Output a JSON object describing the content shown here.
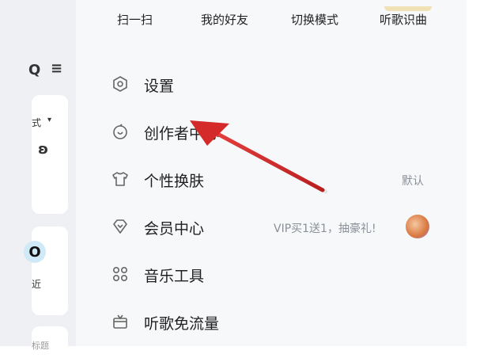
{
  "top_actions": [
    {
      "label": "扫一扫"
    },
    {
      "label": "我的好友"
    },
    {
      "label": "切换模式"
    },
    {
      "label": "听歌识曲"
    }
  ],
  "left_panel": {
    "mode_label": "式",
    "recent_label": "近",
    "bottom_label": "标题"
  },
  "menu": [
    {
      "label": "设置",
      "icon": "hexagon-settings-icon"
    },
    {
      "label": "创作者中心",
      "icon": "creator-icon"
    },
    {
      "label": "个性换肤",
      "icon": "tshirt-icon",
      "extra": "默认"
    },
    {
      "label": "会员中心",
      "icon": "diamond-icon",
      "extra": "VIP买1送1，抽豪礼!"
    },
    {
      "label": "音乐工具",
      "icon": "grid-tools-icon"
    },
    {
      "label": "听歌免流量",
      "icon": "gift-box-icon"
    }
  ],
  "colors": {
    "arrow": "#d42a2a",
    "drawer_bg": "#f7f8fa",
    "accent": "#cfe9f7"
  }
}
